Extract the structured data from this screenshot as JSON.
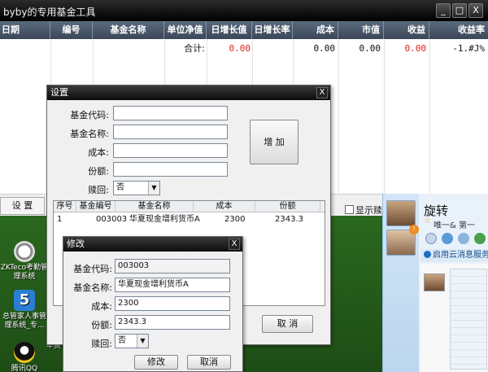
{
  "main_window": {
    "title": "byby的专用基金工具",
    "buttons": {
      "minimize": "_",
      "maximize": "□",
      "close": "X"
    },
    "columns": [
      "日期",
      "编号",
      "基金名称",
      "单位净值",
      "日增长值",
      "日增长率",
      "成本",
      "市值",
      "收益",
      "收益率"
    ],
    "totals": {
      "label": "合计:",
      "daily_growth": "0.00",
      "cost": "0.00",
      "market_value": "0.00",
      "profit": "0.00",
      "return_rate": "-1.#J%"
    },
    "settings_button": "设 置",
    "show_redeemed_label": "显示赎回"
  },
  "settings_dialog": {
    "title": "设置",
    "close": "X",
    "fields": {
      "fund_code_label": "基金代码:",
      "fund_name_label": "基金名称:",
      "cost_label": "成本:",
      "shares_label": "份额:",
      "redeem_label": "赎回:",
      "redeem_value": "否"
    },
    "add_button": "增 加",
    "cancel_button": "取 消",
    "list": {
      "headers": [
        "序号",
        "基金编号",
        "基金名称",
        "成本",
        "份额"
      ],
      "rows": [
        [
          "1",
          "003003",
          "华夏现金增利货币A",
          "2300",
          "2343.3"
        ]
      ]
    }
  },
  "edit_dialog": {
    "title": "修改",
    "close": "X",
    "fields": {
      "fund_code_label": "基金代码:",
      "fund_code_value": "003003",
      "fund_name_label": "基金名称:",
      "fund_name_value": "华夏现金增利货币A",
      "cost_label": "成本:",
      "cost_value": "2300",
      "shares_label": "份额:",
      "shares_value": "2343.3",
      "redeem_label": "赎回:",
      "redeem_value": "否"
    },
    "modify_button": "修改",
    "cancel_button": "取消"
  },
  "qq_panel": {
    "contact_name": "旋转",
    "signature": "唯一& 第一",
    "link_text": "启用云消息服务，"
  },
  "desktop_icons": [
    {
      "label": "ZKTeco考勤管理系统",
      "icon": "clock-icon"
    },
    {
      "label": "总管家人事管理系统_专...",
      "icon": "five-icon"
    },
    {
      "label": "腾讯QQ",
      "icon": "qq-penguin-icon"
    },
    {
      "label": "华费",
      "icon": "app-icon"
    }
  ],
  "colors": {
    "red_value": "#e02020",
    "header_bg": "#4a5668",
    "title_bg": "#111111"
  }
}
